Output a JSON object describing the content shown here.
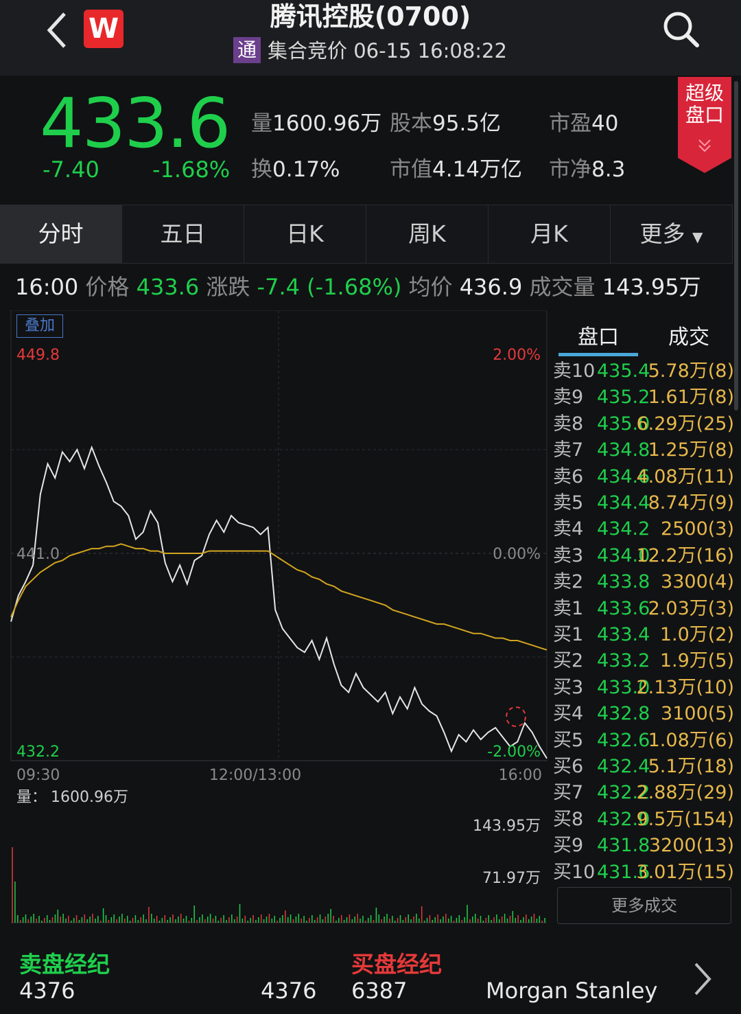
{
  "header": {
    "title": "腾讯控股(0700)",
    "badge": "通",
    "logo_letter": "W",
    "status": "集合竞价 06-15 16:08:22"
  },
  "quote": {
    "price": "433.6",
    "change": "-7.40",
    "change_pct": "-1.68%",
    "volume_label": "量",
    "volume": "1600.96万",
    "share_cap_label": "股本",
    "share_cap": "95.5亿",
    "pe_label": "市盈",
    "pe": "40",
    "turnover_label": "换",
    "turnover": "0.17%",
    "mkt_cap_label": "市值",
    "mkt_cap": "4.14万亿",
    "pb_label": "市净",
    "pb": "8.3",
    "super_orderbook_line1": "超级",
    "super_orderbook_line2": "盘口"
  },
  "tabs": [
    {
      "label": "分时",
      "active": true
    },
    {
      "label": "五日"
    },
    {
      "label": "日K"
    },
    {
      "label": "周K"
    },
    {
      "label": "月K"
    },
    {
      "label": "更多"
    }
  ],
  "info": {
    "time": "16:00",
    "price_label": "价格",
    "price": "433.6",
    "chg_label": "涨跌",
    "chg": "-7.4 (-1.68%)",
    "avg_label": "均价",
    "avg": "436.9",
    "vol_label": "成交量",
    "vol": "143.95万"
  },
  "chart_data": {
    "type": "line",
    "overlay_button": "叠加",
    "y_top_label": "449.8",
    "y_mid_label": "441.0",
    "y_bot_label": "432.2",
    "pct_top_label": "2.00%",
    "pct_mid_label": "0.00%",
    "pct_bot_label": "-2.00%",
    "ylim": [
      432.2,
      449.8
    ],
    "x_labels": [
      "09:30",
      "12:00/13:00",
      "16:00"
    ],
    "volume_label": "量：",
    "volume_total": "1600.96万",
    "volume_max_label": "143.95万",
    "volume_mid_label": "71.97万",
    "series": [
      {
        "color": "#e6e6e6",
        "values": [
          438.1,
          439.2,
          439.8,
          440.5,
          443.5,
          444.8,
          444.2,
          445.3,
          444.9,
          445.4,
          444.6,
          445.5,
          444.7,
          444.0,
          443.2,
          443.0,
          442.6,
          441.6,
          441.9,
          442.8,
          442.3,
          440.6,
          439.8,
          440.5,
          439.7,
          440.7,
          440.9,
          441.8,
          442.4,
          441.9,
          442.6,
          442.3,
          442.2,
          442.1,
          441.8,
          442.1,
          438.6,
          437.8,
          437.4,
          437.0,
          436.8,
          437.3,
          436.5,
          437.4,
          436.3,
          435.4,
          435.1,
          435.9,
          435.3,
          435.0,
          434.7,
          435.1,
          434.2,
          434.9,
          434.4,
          435.3,
          434.6,
          434.3,
          434.1,
          433.4,
          432.6,
          433.3,
          433.0,
          433.5,
          433.1,
          433.4,
          433.6,
          433.2,
          432.8,
          433.0,
          433.8,
          433.4,
          432.8,
          432.3
        ]
      },
      {
        "color": "#d2a51f",
        "values": [
          438.3,
          439.0,
          439.6,
          439.9,
          440.2,
          440.4,
          440.6,
          440.7,
          440.9,
          441.0,
          441.1,
          441.2,
          441.2,
          441.3,
          441.3,
          441.4,
          441.3,
          441.2,
          441.2,
          441.1,
          441.1,
          441.0,
          441.0,
          441.0,
          441.0,
          441.0,
          441.0,
          441.1,
          441.1,
          441.1,
          441.1,
          441.1,
          441.1,
          441.1,
          441.1,
          441.1,
          440.9,
          440.7,
          440.5,
          440.3,
          440.2,
          440.0,
          439.9,
          439.7,
          439.6,
          439.4,
          439.3,
          439.2,
          439.1,
          439.0,
          438.9,
          438.8,
          438.6,
          438.5,
          438.4,
          438.3,
          438.2,
          438.1,
          438.0,
          438.0,
          437.9,
          437.8,
          437.7,
          437.6,
          437.6,
          437.5,
          437.4,
          437.4,
          437.3,
          437.3,
          437.2,
          437.1,
          437.0,
          436.9
        ]
      }
    ]
  },
  "orderbook": {
    "tab_active": "盘口",
    "tab_other": "成交",
    "rows": [
      {
        "level": "卖10",
        "price": "435.4",
        "vol": "5.78万(8)"
      },
      {
        "level": "卖9",
        "price": "435.2",
        "vol": "1.61万(8)"
      },
      {
        "level": "卖8",
        "price": "435.0",
        "vol": "6.29万(25)"
      },
      {
        "level": "卖7",
        "price": "434.8",
        "vol": "1.25万(8)"
      },
      {
        "level": "卖6",
        "price": "434.6",
        "vol": "4.08万(11)"
      },
      {
        "level": "卖5",
        "price": "434.4",
        "vol": "8.74万(9)"
      },
      {
        "level": "卖4",
        "price": "434.2",
        "vol": "2500(3)"
      },
      {
        "level": "卖3",
        "price": "434.0",
        "vol": "12.2万(16)"
      },
      {
        "level": "卖2",
        "price": "433.8",
        "vol": "3300(4)"
      },
      {
        "level": "卖1",
        "price": "433.6",
        "vol": "2.03万(3)"
      },
      {
        "level": "买1",
        "price": "433.4",
        "vol": "1.0万(2)"
      },
      {
        "level": "买2",
        "price": "433.2",
        "vol": "1.9万(5)"
      },
      {
        "level": "买3",
        "price": "433.0",
        "vol": "2.13万(10)"
      },
      {
        "level": "买4",
        "price": "432.8",
        "vol": "3100(5)"
      },
      {
        "level": "买5",
        "price": "432.6",
        "vol": "1.08万(6)"
      },
      {
        "level": "买6",
        "price": "432.4",
        "vol": "5.1万(18)"
      },
      {
        "level": "买7",
        "price": "432.2",
        "vol": "2.88万(29)"
      },
      {
        "level": "买8",
        "price": "432.0",
        "vol": "9.5万(154)"
      },
      {
        "level": "买9",
        "price": "431.8",
        "vol": "3200(13)"
      },
      {
        "level": "买10",
        "price": "431.6",
        "vol": "3.01万(15)"
      }
    ],
    "more_trades": "更多成交"
  },
  "broker": {
    "sell_title": "卖盘经纪",
    "buy_title": "买盘经纪",
    "sell_left": "4376",
    "sell_right": "4376",
    "buy_left": "6387",
    "buy_right": "Morgan Stanley"
  }
}
